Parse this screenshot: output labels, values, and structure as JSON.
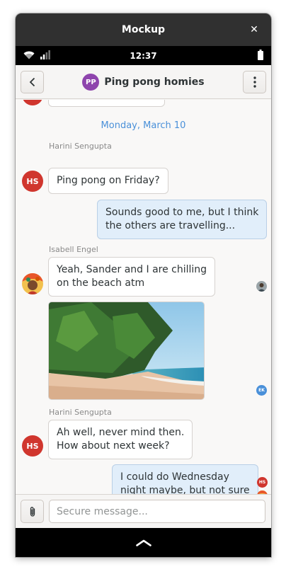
{
  "window": {
    "title": "Mockup",
    "close_glyph": "✕"
  },
  "statusbar": {
    "time": "12:37"
  },
  "header": {
    "back_icon": "chevron-left-icon",
    "group_initials": "PP",
    "title": "Ping pong homies",
    "menu_icon": "kebab-menu-icon"
  },
  "chat": {
    "date_separator": "Monday, March 10",
    "messages": [
      {
        "sender": "Harini Sengupta",
        "initials": "HS",
        "text": "Ping pong on Friday?"
      },
      {
        "text_line1": "Sounds good to me, but I think",
        "text_line2": "the others are travelling..."
      },
      {
        "sender": "Isabell Engel",
        "text_line1": "Yeah, Sander and I are chilling",
        "text_line2": "on the beach atm"
      },
      {
        "sender": "Harini Sengupta",
        "initials": "HS",
        "text_line1": "Ah well, never mind then.",
        "text_line2": "How about next week?"
      },
      {
        "text_line1": "I could do Wednesday",
        "text_line2": "night maybe, but not sure"
      }
    ],
    "receipts": {
      "ek": "EK",
      "hs": "HS"
    }
  },
  "composer": {
    "placeholder": "Secure message..."
  },
  "colors": {
    "accent": "#4a90d9",
    "avatar_hs": "#d0362e",
    "avatar_pp": "#8e44ad",
    "outgoing_bubble": "#e1eefa"
  }
}
